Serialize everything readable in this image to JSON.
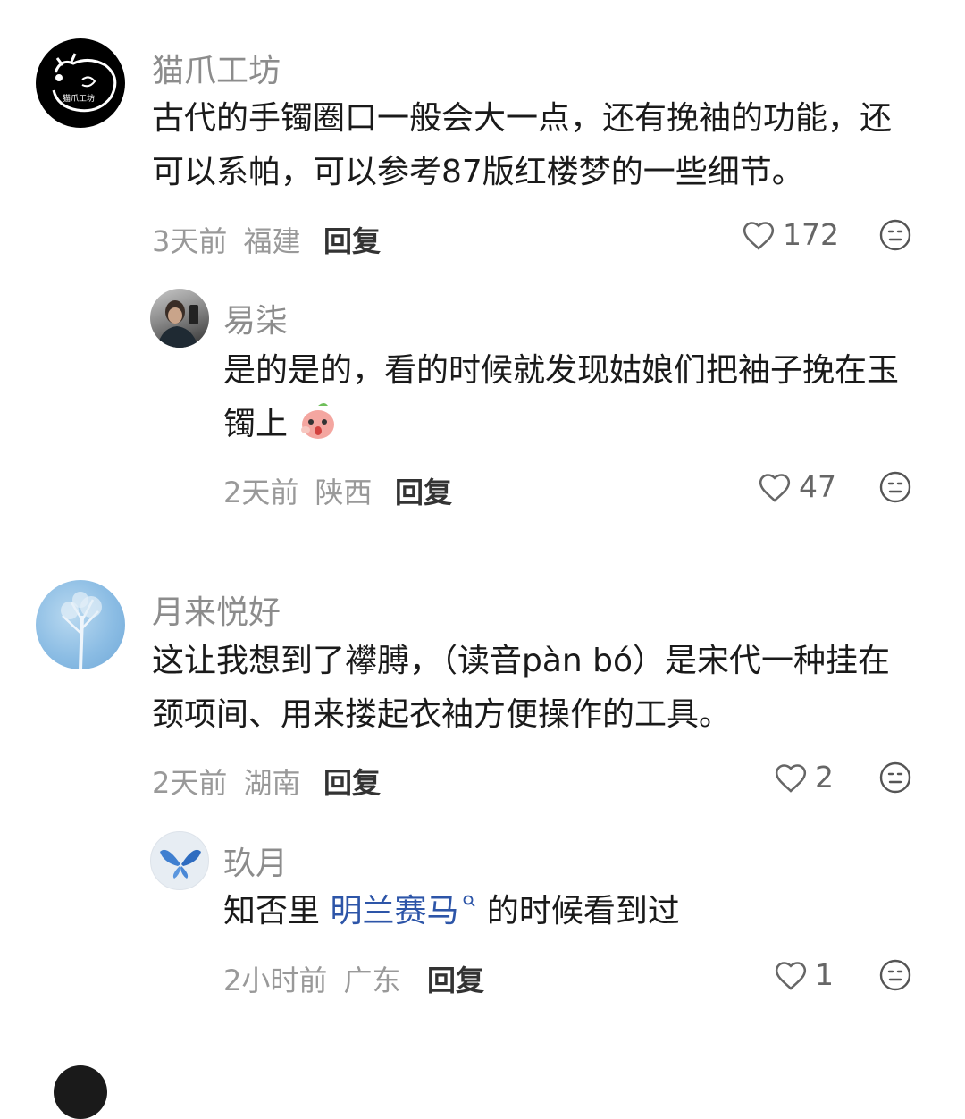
{
  "comments": [
    {
      "username": "猫爪工坊",
      "avatar_text": "猫爪工坊",
      "text": "古代的手镯圈口一般会大一点，还有挽袖的功能，还可以系帕，可以参考87版红楼梦的一些细节。",
      "time": "3天前",
      "location": "福建",
      "reply_label": "回复",
      "likes": "172"
    },
    {
      "username": "易柒",
      "text": "是的是的，看的时候就发现姑娘们把袖子挽在玉镯上",
      "time": "2天前",
      "location": "陕西",
      "reply_label": "回复",
      "likes": "47"
    },
    {
      "username": "月来悦好",
      "text": "这让我想到了襻膊，（读音pàn bó）是宋代一种挂在颈项间、用来搂起衣袖方便操作的工具。",
      "time": "2天前",
      "location": "湖南",
      "reply_label": "回复",
      "likes": "2"
    },
    {
      "username": "玖月",
      "text_before": "知否里 ",
      "link_text": "明兰赛马",
      "text_after": " 的时候看到过",
      "time": "2小时前",
      "location": "广东",
      "reply_label": "回复",
      "likes": "1"
    }
  ],
  "icons": {
    "like": "heart-outline-icon",
    "more": "emoji-face-icon",
    "search": "search-icon"
  },
  "colors": {
    "link": "#2d55a8",
    "meta": "#999999",
    "name": "#8c8c8c"
  }
}
